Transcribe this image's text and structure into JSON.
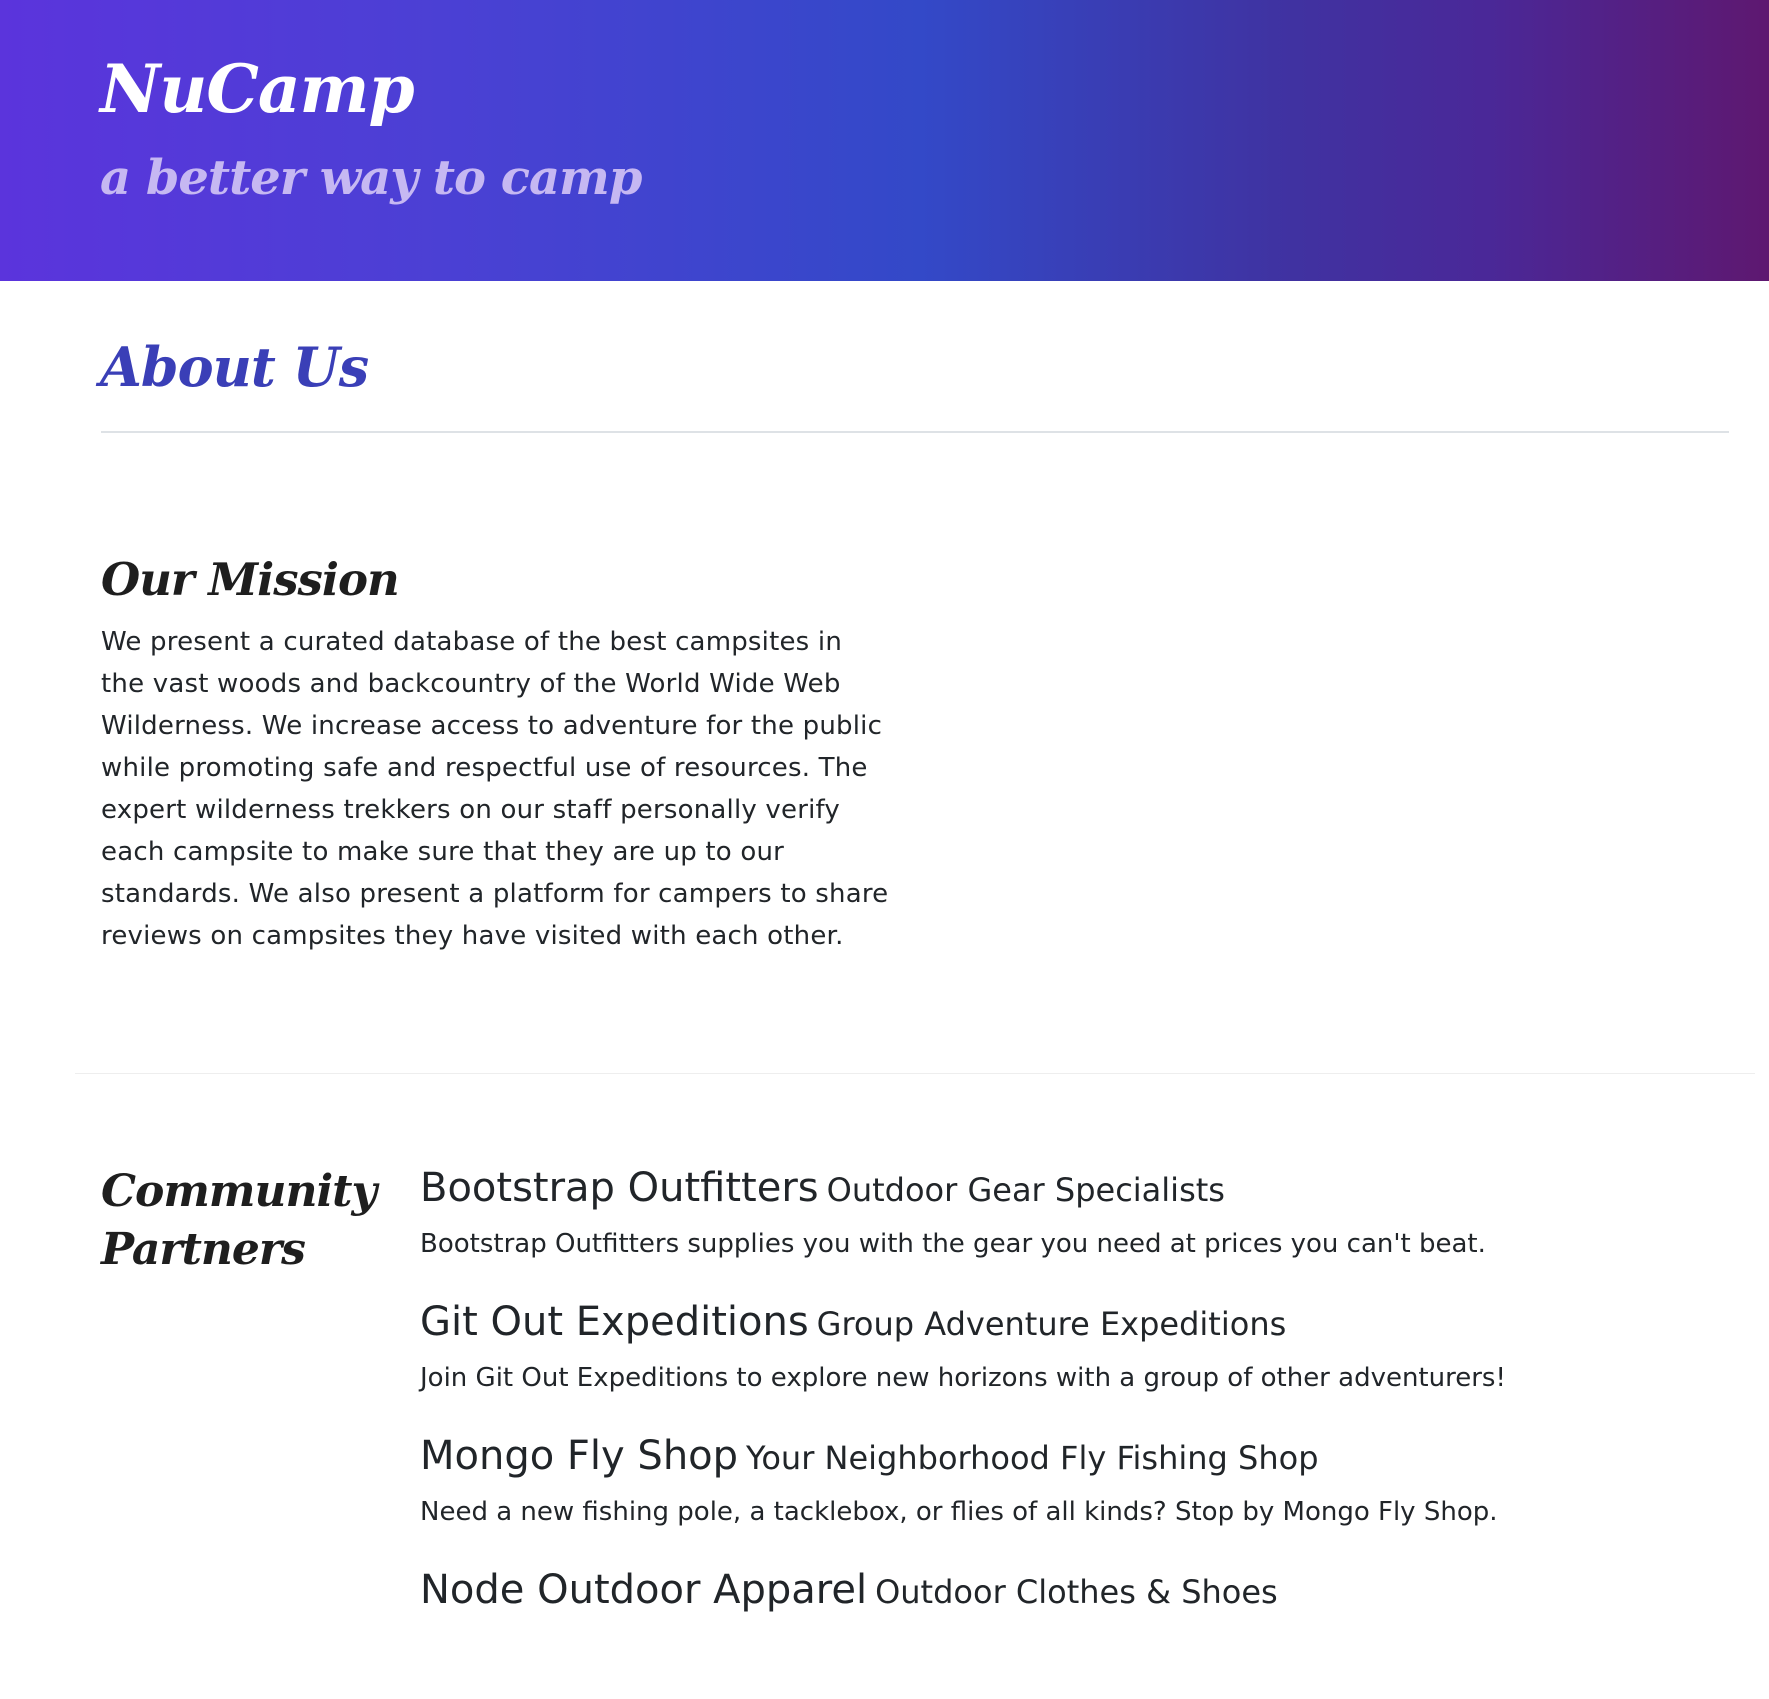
{
  "header": {
    "brand": "NuCamp",
    "tagline": "a better way to camp"
  },
  "page": {
    "title": "About Us"
  },
  "mission": {
    "heading": "Our Mission",
    "text": "We present a curated database of the best campsites in the vast woods and backcountry of the World Wide Web Wilderness. We increase access to adventure for the public while promoting safe and respectful use of resources. The expert wilderness trekkers on our staff personally verify each campsite to make sure that they are up to our standards. We also present a platform for campers to share reviews on campsites they have visited with each other."
  },
  "partners": {
    "heading": "Community Partners",
    "items": [
      {
        "name": "Bootstrap Outfitters",
        "subtitle": "Outdoor Gear Specialists",
        "description": "Bootstrap Outfitters supplies you with the gear you need at prices you can't beat."
      },
      {
        "name": "Git Out Expeditions",
        "subtitle": "Group Adventure Expeditions",
        "description": "Join Git Out Expeditions to explore new horizons with a group of other adventurers!"
      },
      {
        "name": "Mongo Fly Shop",
        "subtitle": "Your Neighborhood Fly Fishing Shop",
        "description": "Need a new fishing pole, a tacklebox, or flies of all kinds? Stop by Mongo Fly Shop."
      },
      {
        "name": "Node Outdoor Apparel",
        "subtitle": "Outdoor Clothes & Shoes",
        "description": ""
      }
    ]
  }
}
